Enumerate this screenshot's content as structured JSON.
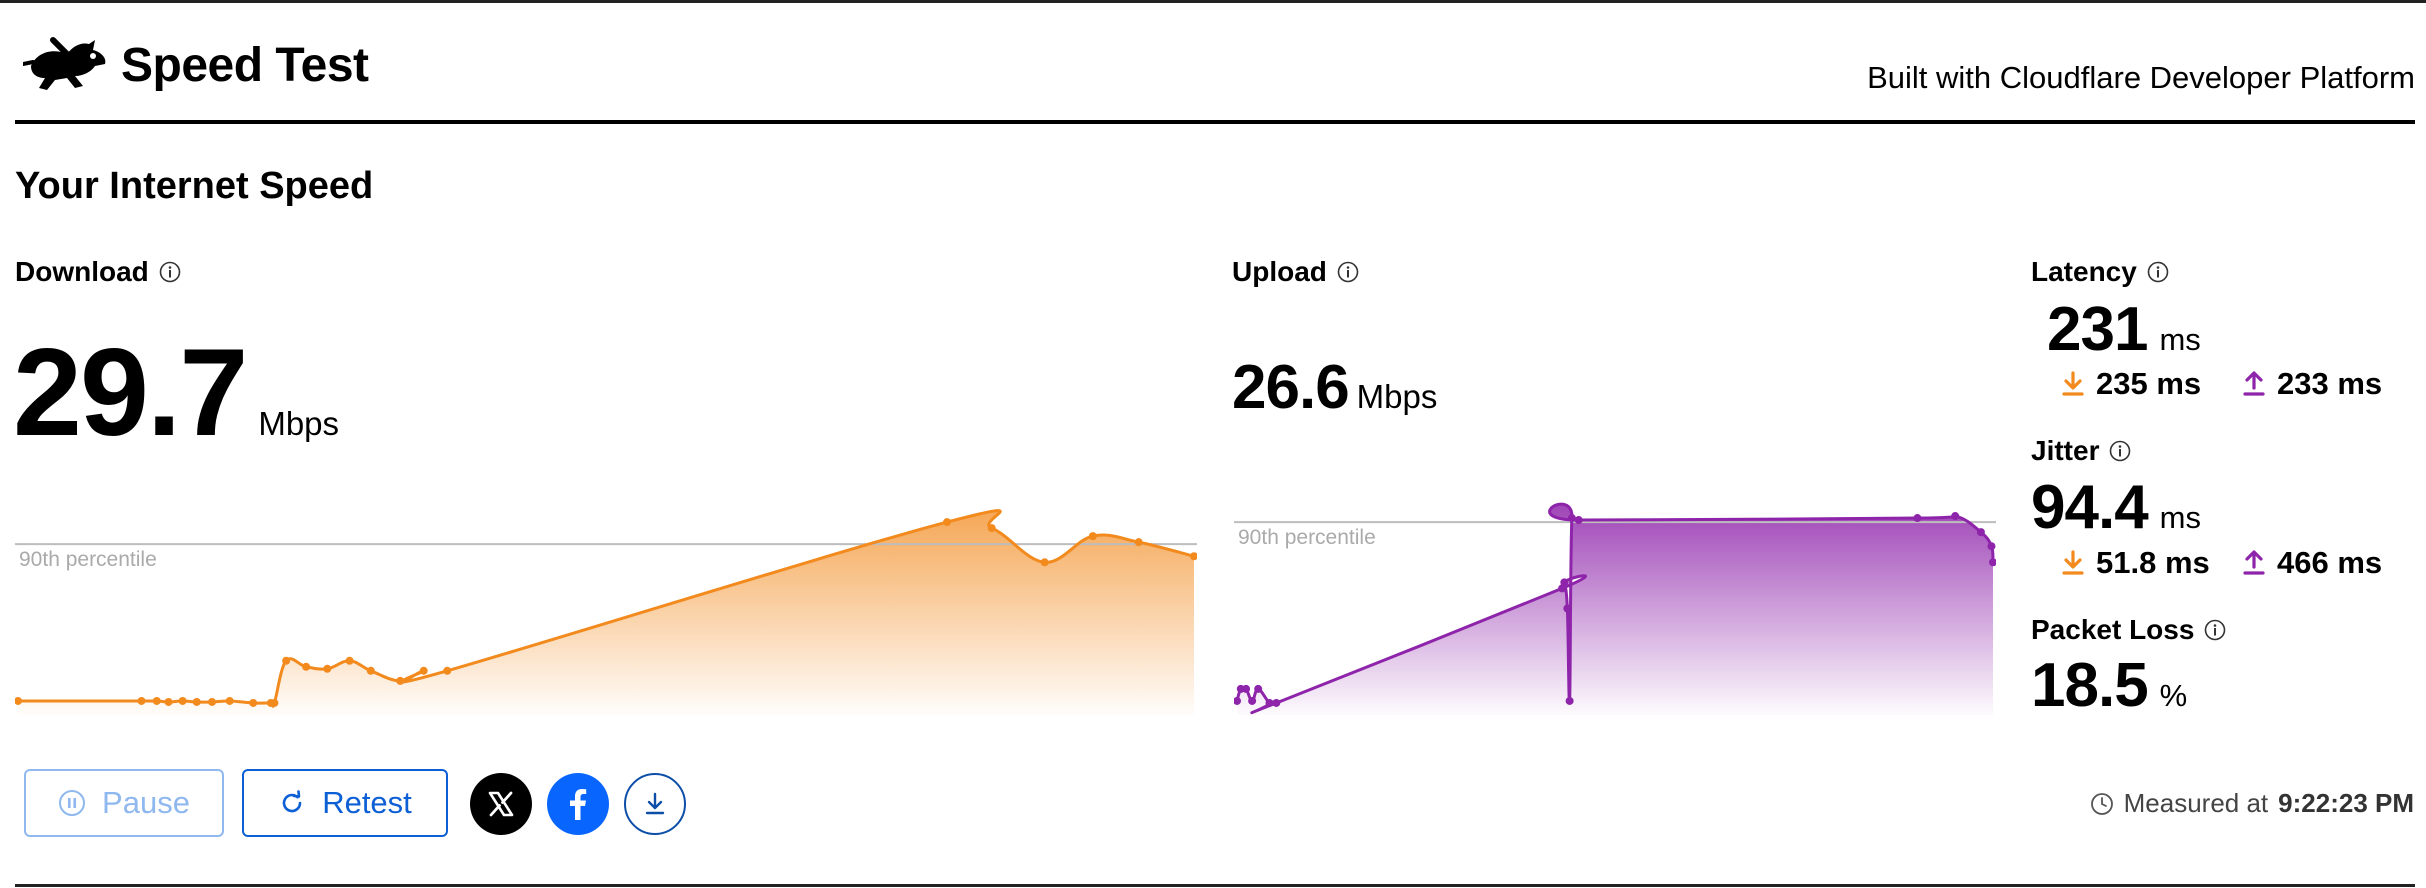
{
  "app": {
    "brand": "Speed Test",
    "built_with": "Built with Cloudflare Developer Platform"
  },
  "section_title": "Your Internet Speed",
  "download": {
    "label": "Download",
    "value": "29.7",
    "unit": "Mbps",
    "percentile_label": "90th percentile",
    "color": "#f28a1e"
  },
  "upload": {
    "label": "Upload",
    "value": "26.6",
    "unit": "Mbps",
    "percentile_label": "90th percentile",
    "color": "#8e24aa"
  },
  "latency": {
    "label": "Latency",
    "value": "231",
    "unit": "ms",
    "down_value": "235 ms",
    "up_value": "233 ms"
  },
  "jitter": {
    "label": "Jitter",
    "value": "94.4",
    "unit": "ms",
    "down_value": "51.8 ms",
    "up_value": "466 ms"
  },
  "packet_loss": {
    "label": "Packet Loss",
    "value": "18.5",
    "unit": "%"
  },
  "actions": {
    "pause_label": "Pause",
    "retest_label": "Retest",
    "icons": [
      "x-logo-icon",
      "facebook-icon",
      "download-icon"
    ]
  },
  "measured": {
    "prefix": "Measured at",
    "time": "9:22:23 PM"
  },
  "chart_data": [
    {
      "type": "area",
      "series": [
        {
          "values": [
            0.04,
            0.04,
            0.04,
            0.035,
            0.04,
            0.035,
            0.035,
            0.04,
            0.03,
            0.03,
            0.03,
            0.24,
            0.21,
            0.2,
            0.24,
            0.19,
            0.14,
            0.19,
            0.19,
            0.93,
            0.9,
            0.73,
            0.86,
            0.83,
            0.76
          ]
        }
      ],
      "x": [
        0,
        0.105,
        0.118,
        0.128,
        0.14,
        0.152,
        0.165,
        0.18,
        0.2,
        0.215,
        0.218,
        0.228,
        0.245,
        0.263,
        0.282,
        0.3,
        0.325,
        0.345,
        0.365,
        0.79,
        0.828,
        0.873,
        0.914,
        0.953,
        1.0
      ],
      "curve_points": "smooth",
      "percentile_90": 0.82,
      "ylim": [
        0,
        1
      ]
    },
    {
      "type": "area",
      "series": [
        {
          "values": [
            0.04,
            0.1,
            0.1,
            0.04,
            0.1,
            0.03,
            0.03,
            0.6,
            0.63,
            0.5,
            0.04,
            0.95,
            0.94,
            0.95,
            0.96,
            0.88,
            0.81,
            0.73
          ]
        }
      ],
      "x": [
        0,
        0.005,
        0.012,
        0.02,
        0.028,
        0.043,
        0.052,
        0.43,
        0.433,
        0.437,
        0.44,
        0.443,
        0.452,
        0.9,
        0.95,
        0.984,
        0.998,
        1.0
      ],
      "percentile_90": 0.93,
      "ylim": [
        0,
        1
      ]
    }
  ]
}
